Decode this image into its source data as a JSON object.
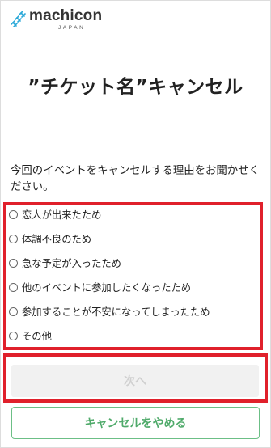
{
  "header": {
    "logo_text": "machicon",
    "logo_sub": "JAPAN"
  },
  "page": {
    "title": "”チケット名”キャンセル",
    "prompt": "今回のイベントをキャンセルする理由をお聞かせください。"
  },
  "reasons": [
    {
      "label": "恋人が出来たため",
      "selected": false
    },
    {
      "label": "体調不良のため",
      "selected": false
    },
    {
      "label": "急な予定が入ったため",
      "selected": false
    },
    {
      "label": "他のイベントに参加したくなったため",
      "selected": false
    },
    {
      "label": "参加することが不安になってしまったため",
      "selected": false
    },
    {
      "label": "その他",
      "selected": false
    }
  ],
  "buttons": {
    "next_label": "次へ",
    "next_disabled": true,
    "cancel_label": "キャンセルをやめる"
  },
  "colors": {
    "highlight": "#e0202b",
    "accent_green": "#4faa6a",
    "logo_blue": "#2aa8d8"
  }
}
